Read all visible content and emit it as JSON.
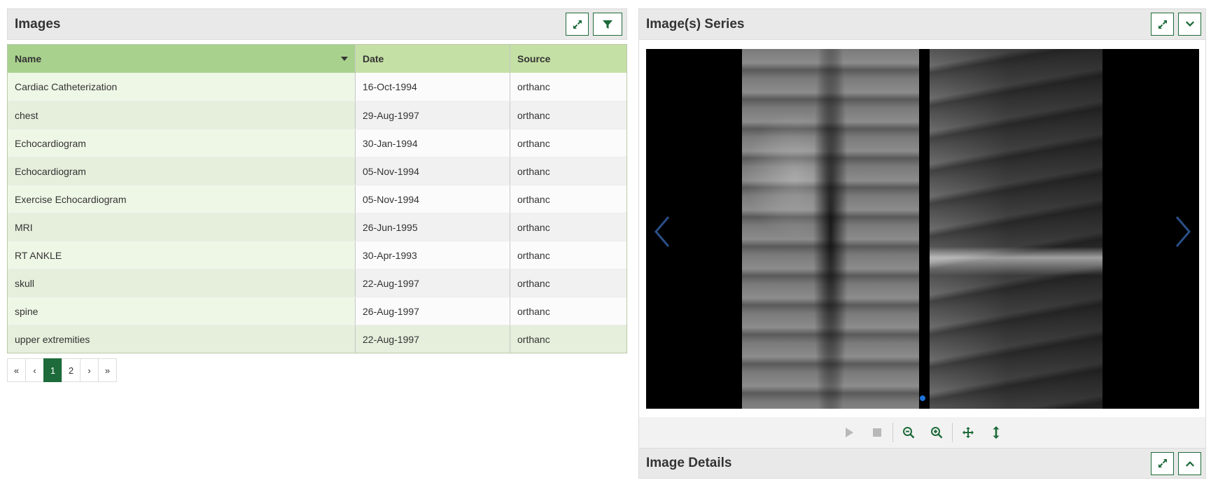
{
  "images_panel": {
    "title": "Images",
    "columns": [
      "Name",
      "Date",
      "Source"
    ],
    "rows": [
      {
        "name": "Cardiac Catheterization",
        "date": "16-Oct-1994",
        "source": "orthanc"
      },
      {
        "name": "chest",
        "date": "29-Aug-1997",
        "source": "orthanc"
      },
      {
        "name": "Echocardiogram",
        "date": "30-Jan-1994",
        "source": "orthanc"
      },
      {
        "name": "Echocardiogram",
        "date": "05-Nov-1994",
        "source": "orthanc"
      },
      {
        "name": "Exercise Echocardiogram",
        "date": "05-Nov-1994",
        "source": "orthanc"
      },
      {
        "name": "MRI",
        "date": "26-Jun-1995",
        "source": "orthanc"
      },
      {
        "name": "RT ANKLE",
        "date": "30-Apr-1993",
        "source": "orthanc"
      },
      {
        "name": "skull",
        "date": "22-Aug-1997",
        "source": "orthanc"
      },
      {
        "name": "spine",
        "date": "26-Aug-1997",
        "source": "orthanc"
      },
      {
        "name": "upper extremities",
        "date": "22-Aug-1997",
        "source": "orthanc"
      }
    ],
    "pager": {
      "first": "«",
      "prev": "‹",
      "pages": [
        "1",
        "2"
      ],
      "current": "1",
      "next": "›",
      "last": "»"
    }
  },
  "series_panel": {
    "title": "Image(s) Series"
  },
  "details_panel": {
    "title": "Image Details"
  },
  "colors": {
    "accent": "#1d6b3a",
    "header_name": "#a9d18e",
    "header_other": "#c5e0a5",
    "dot": "#1e73d8"
  },
  "icons": {
    "expand": "expand-icon",
    "filter": "filter-icon",
    "collapse": "chevron-down-icon",
    "expand_up": "chevron-up-icon",
    "play": "play-icon",
    "stop": "stop-icon",
    "zoom_out": "zoom-out-icon",
    "zoom_in": "zoom-in-icon",
    "pan": "move-icon",
    "scroll": "vertical-resize-icon"
  }
}
